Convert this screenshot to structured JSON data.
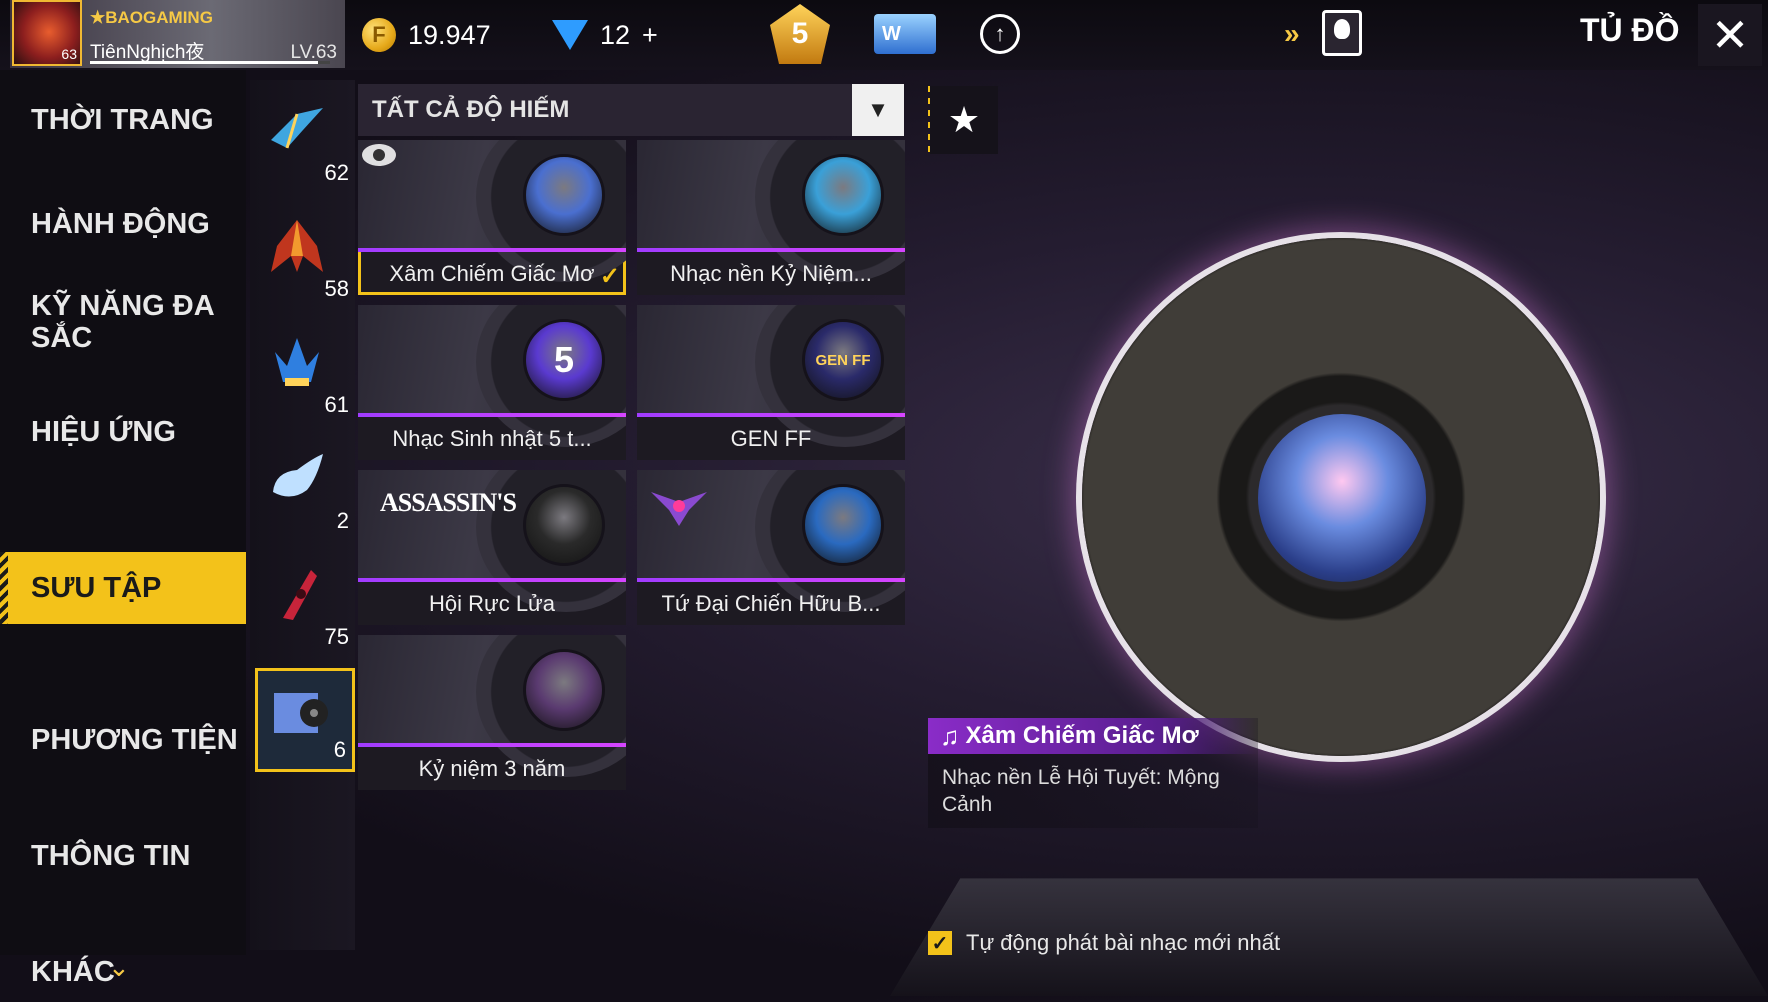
{
  "header": {
    "guild": "BAOGAMING",
    "player_name": "TiênNghịch夜",
    "level": "LV.63",
    "avatar_level": "63",
    "xp_fraction": 0.95,
    "gold": "19.947",
    "diamonds": "12",
    "diamonds_plus": "+",
    "rank_badge": "5",
    "wish_label": "W",
    "page_title": "TỦ ĐỒ"
  },
  "left_nav": [
    {
      "label": "THỜI TRANG"
    },
    {
      "label": "HÀNH ĐỘNG"
    },
    {
      "label": "KỸ NĂNG ĐA SẮC"
    },
    {
      "label": "HIỆU ỨNG"
    },
    {
      "label": "SƯU TẬP",
      "active": true
    },
    {
      "label": "PHƯƠNG TIỆN"
    },
    {
      "label": "THÔNG TIN"
    },
    {
      "label": "KHÁC"
    }
  ],
  "categories": [
    {
      "icon": "glider-icon",
      "count": "62"
    },
    {
      "icon": "wings-icon",
      "count": "58"
    },
    {
      "icon": "crown-icon",
      "count": "61"
    },
    {
      "icon": "cloud-effect-icon",
      "count": "2"
    },
    {
      "icon": "skyboard-icon",
      "count": "75"
    },
    {
      "icon": "music-album-icon",
      "count": "6",
      "selected": true
    }
  ],
  "filter": {
    "label": "TẤT CẢ ĐỘ HIẾM"
  },
  "cards": [
    {
      "title": "Xâm Chiếm Giấc Mơ",
      "selected": true,
      "cover_color": "#4a6fd0"
    },
    {
      "title": "Nhạc nền Kỷ Niệm...",
      "cover_color": "#3aa0d8"
    },
    {
      "title": "Nhạc Sinh nhật 5 t...",
      "cover_color": "#5a3ad0",
      "cover_text": "5"
    },
    {
      "title": "GEN FF",
      "cover_color": "#2a2a6a",
      "cover_text": "GEN FF"
    },
    {
      "title": "Hội Rực Lửa",
      "cover_color": "#2a2a2a",
      "overlay": "ASSASSIN'S"
    },
    {
      "title": "Tứ Đại Chiến Hữu B...",
      "cover_color": "#2a6ac0"
    },
    {
      "title": "Kỷ niệm 3 năm",
      "cover_color": "#5a3a70"
    }
  ],
  "preview": {
    "title": "Xâm Chiếm Giấc Mơ",
    "description": "Nhạc nền Lễ Hội Tuyết: Mộng Cảnh"
  },
  "autoplay": {
    "label": "Tự động phát bài nhạc mới nhất",
    "checked": true
  },
  "colors": {
    "accent": "#f3c21a",
    "purple": "#a13cff"
  }
}
